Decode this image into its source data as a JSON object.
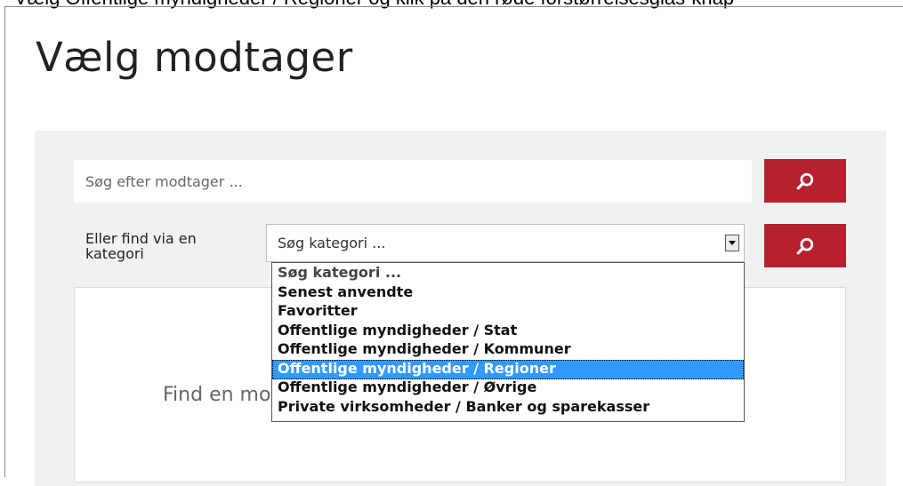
{
  "instruction": "Vælg Offentlige myndigheder / Regioner og klik på den røde forstørrelsesglas-knap",
  "page_title": "Vælg modtager",
  "search": {
    "placeholder": "Søg efter modtager ...",
    "button_icon": "search-icon"
  },
  "category": {
    "label": "Eller find via en kategori",
    "selected": "Søg kategori ...",
    "button_icon": "search-icon",
    "options": [
      "Søg kategori ...",
      "Senest anvendte",
      "Favoritter",
      "Offentlige myndigheder / Stat",
      "Offentlige myndigheder / Kommuner",
      "Offentlige myndigheder / Regioner",
      "Offentlige myndigheder / Øvrige",
      "Private virksomheder / Banker og sparekasser"
    ],
    "highlighted_option": "Offentlige myndigheder / Regioner"
  },
  "results": {
    "placeholder_text": "Find en modtager ved at søge eller vælge en kategori"
  },
  "colors": {
    "accent_red": "#b5212f",
    "panel_bg": "#f1f1f1",
    "highlight_blue": "#3399ff"
  }
}
